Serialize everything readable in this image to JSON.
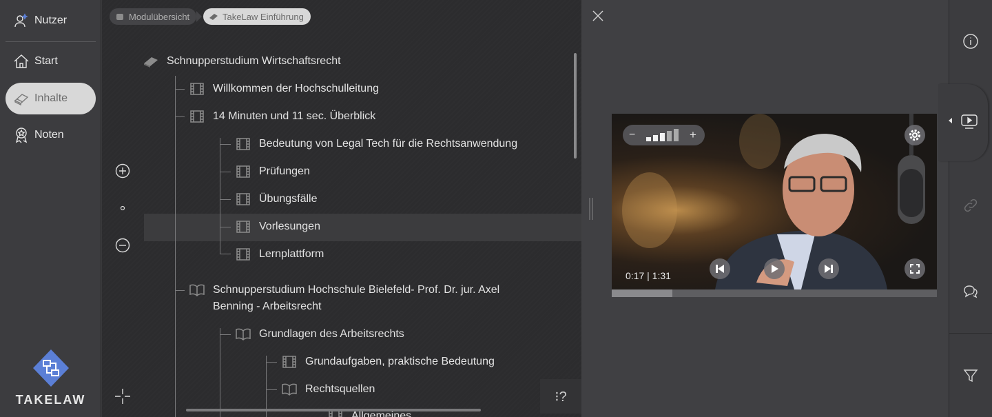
{
  "nav": {
    "user_label": "Nutzer",
    "items": [
      {
        "label": "Start",
        "icon": "home-icon"
      },
      {
        "label": "Inhalte",
        "icon": "book-icon"
      },
      {
        "label": "Noten",
        "icon": "award-icon"
      }
    ],
    "active": "Inhalte",
    "logo_text": "TAKELAW"
  },
  "breadcrumb": [
    {
      "label": "Modulübersicht",
      "icon": "modules-icon"
    },
    {
      "label": "TakeLaw Einführung",
      "icon": "book-icon"
    }
  ],
  "tree": [
    {
      "label": "Schnupperstudium Wirtschaftsrecht",
      "icon": "book-stack-icon"
    },
    {
      "label": "Willkommen der Hochschulleitung",
      "icon": "film-icon"
    },
    {
      "label": "14 Minuten und 11 sec. Überblick",
      "icon": "film-icon"
    },
    {
      "label": "Bedeutung von Legal Tech für die Rechtsanwendung",
      "icon": "film-icon"
    },
    {
      "label": "Prüfungen",
      "icon": "film-icon"
    },
    {
      "label": "Übungsfälle",
      "icon": "film-icon"
    },
    {
      "label": "Vorlesungen",
      "icon": "film-icon",
      "selected": true
    },
    {
      "label": "Lernplattform",
      "icon": "film-icon"
    },
    {
      "label_line1": "Schnupperstudium Hochschule Bielefeld- Prof. Dr. jur. Axel",
      "label_line2": "Benning - Arbeitsrecht",
      "icon": "open-book-icon"
    },
    {
      "label": "Grundlagen des Arbeitsrechts",
      "icon": "open-book-icon"
    },
    {
      "label": "Grundaufgaben, praktische Bedeutung",
      "icon": "film-icon"
    },
    {
      "label": "Rechtsquellen",
      "icon": "open-book-icon"
    },
    {
      "label": "Allgemeines",
      "icon": "film-icon"
    }
  ],
  "help_label": "⁝?",
  "video": {
    "time_current": "0:17",
    "time_total": "1:31",
    "time_display": "0:17 | 1:31",
    "progress": 0.187,
    "volume_level": "3 of 5"
  },
  "colors": {
    "active_nav_bg": "#d8d8d8",
    "logo_accent": "#5b7fd6",
    "panel_dark": "#2c2c2e"
  }
}
